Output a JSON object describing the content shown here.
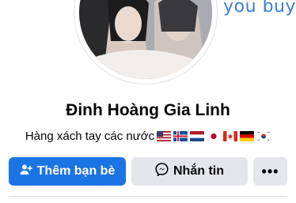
{
  "cover": {
    "text": "you buy"
  },
  "profile": {
    "name": "Đinh Hoàng Gia Linh",
    "bio": "Hàng xách tay các nước",
    "bio_flags": [
      "us-flag",
      "iceland-flag",
      "netherlands-flag",
      "japan-flag",
      "canada-flag",
      "germany-flag",
      "south-korea-flag"
    ]
  },
  "actions": {
    "add_friend": {
      "label": "Thêm bạn bè",
      "icon": "add-person-icon"
    },
    "message": {
      "label": "Nhắn tin",
      "icon": "messenger-icon"
    },
    "more": {
      "label": "•••",
      "icon": "more-icon"
    }
  },
  "colors": {
    "primary": "#1b74e4",
    "secondary": "#e4e6eb",
    "cover_text": "#3b7fd4"
  }
}
